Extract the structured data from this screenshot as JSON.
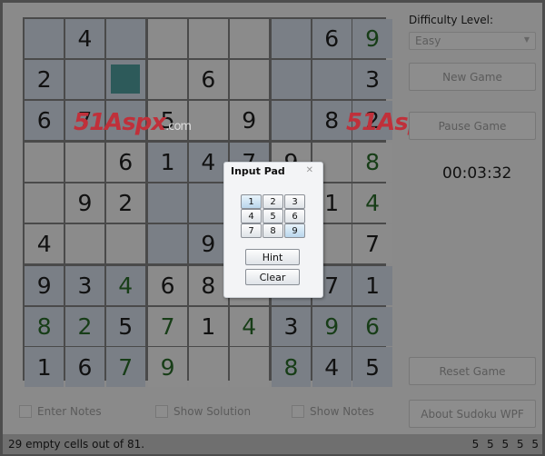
{
  "board": [
    [
      "",
      "4",
      "",
      "",
      "",
      "",
      "",
      "6",
      "9g"
    ],
    [
      "2",
      "",
      "",
      "",
      "6",
      "",
      "",
      "",
      "3"
    ],
    [
      "6",
      "7",
      "",
      "5",
      "",
      "9",
      "",
      "8",
      "2"
    ],
    [
      "",
      "",
      "6",
      "1",
      "4",
      "7",
      "9",
      "",
      "8g"
    ],
    [
      "",
      "9",
      "2",
      "",
      "",
      "",
      "",
      "1",
      "4g"
    ],
    [
      "4",
      "",
      "",
      "",
      "9",
      "",
      "",
      "",
      "7"
    ],
    [
      "9",
      "3",
      "4g",
      "6",
      "8",
      "",
      "",
      "7",
      "1"
    ],
    [
      "8g",
      "2g",
      "5",
      "7g",
      "1",
      "4g",
      "3",
      "9g",
      "6g"
    ],
    [
      "1",
      "6",
      "7g",
      "9g",
      "",
      "",
      "8g",
      "4",
      "5"
    ]
  ],
  "selected_cell": "row 2, column 3",
  "colors": {
    "given": "#111111",
    "entered": "#173d17",
    "selected": "#2d5a5a"
  },
  "watermark": {
    "text": "51Aspx",
    "suffix": ".com"
  },
  "sidebar": {
    "difficulty_label": "Difficulty Level:",
    "difficulty_value": "Easy",
    "new_game": "New Game",
    "pause_game": "Pause Game",
    "timer": "00:03:32",
    "reset_game": "Reset Game",
    "about": "About Sudoku WPF"
  },
  "options": {
    "enter_notes": "Enter Notes",
    "show_solution": "Show Solution",
    "show_notes": "Show Notes"
  },
  "status": {
    "message": "29 empty cells out of 81.",
    "counts": "5 5 5 5 5"
  },
  "input_pad": {
    "title": "Input Pad",
    "numbers": [
      "1",
      "2",
      "3",
      "4",
      "5",
      "6",
      "7",
      "8",
      "9"
    ],
    "hint": "Hint",
    "clear": "Clear"
  }
}
